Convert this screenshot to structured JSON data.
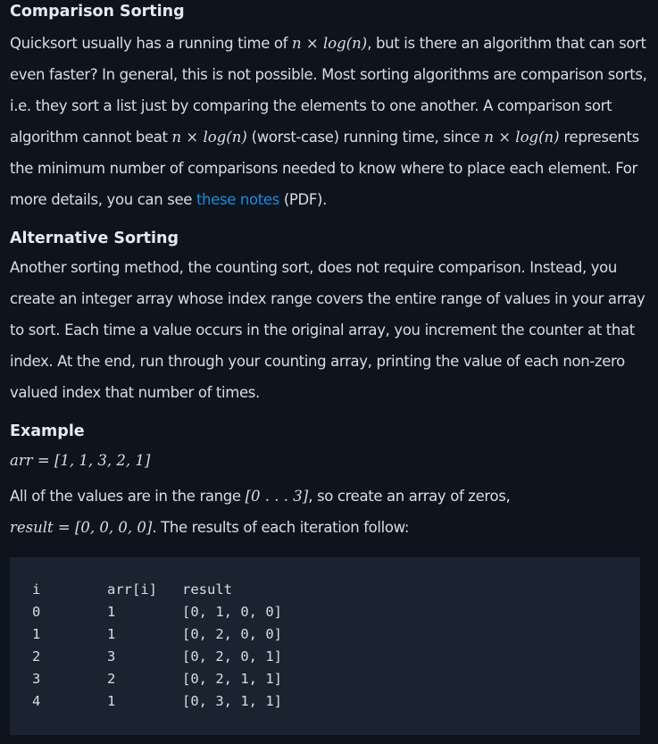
{
  "section_comparison": {
    "title": "Comparison Sorting",
    "p1": "Quicksort usually has a running time of ",
    "math1": "n × log(n)",
    "p2": ", but is there an algorithm that can sort even faster? In general, this is not possible. Most sorting algorithms are comparison sorts, i.e. they sort a list just by comparing the elements to one another. A comparison sort algorithm cannot beat ",
    "math2": "n × log(n)",
    "p3": " (worst-case) running time, since ",
    "math3": "n × log(n)",
    "p4": " represents the minimum number of comparisons needed to know where to place each element. For more details, you can see ",
    "link": "these notes",
    "p5": " (PDF)."
  },
  "section_alternative": {
    "title": "Alternative Sorting",
    "body": "Another sorting method, the counting sort, does not require comparison. Instead, you create an integer array whose index range covers the entire range of values in your array to sort. Each time a value occurs in the original array, you increment the counter at that index. At the end, run through your counting array, printing the value of each non-zero valued index that number of times."
  },
  "section_example": {
    "title": "Example",
    "arr_var": "arr",
    "arr_eq": " = ",
    "arr_value": "[1, 1, 3, 2, 1]",
    "range_text1": "All of the values are in the range ",
    "range_value": "[0 . . . 3]",
    "range_text2": ", so create an array of zeros,",
    "result_var": "result",
    "result_eq": " = ",
    "result_value": "[0, 0, 0, 0]",
    "result_text": ". The results of each iteration follow:"
  },
  "code_table": {
    "headers": [
      "i",
      "arr[i]",
      "result"
    ],
    "rows": [
      [
        "0",
        "1",
        "[0, 1, 0, 0]"
      ],
      [
        "1",
        "1",
        "[0, 2, 0, 0]"
      ],
      [
        "2",
        "3",
        "[0, 2, 0, 1]"
      ],
      [
        "3",
        "2",
        "[0, 2, 1, 1]"
      ],
      [
        "4",
        "1",
        "[0, 3, 1, 1]"
      ]
    ]
  }
}
